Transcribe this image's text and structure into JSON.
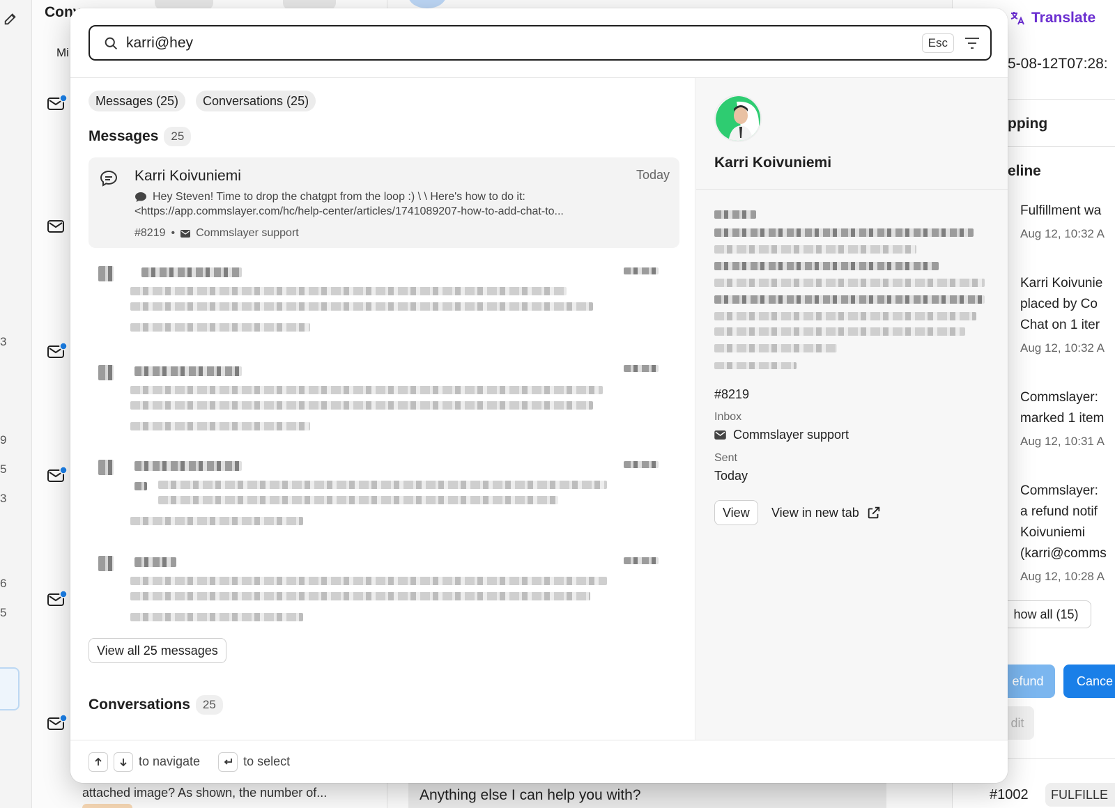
{
  "background": {
    "list_title": "Conv",
    "filter_label": "Mi",
    "rail_numbers": [
      "3",
      "9",
      "5",
      "3",
      "6",
      "5"
    ],
    "list_snippet": "attached image? As shown, the number of...",
    "chat_snippet": "Anything else I can help you with?",
    "translate_label": "Translate",
    "right_panel": {
      "timestamp": "5-08-12T07:28:",
      "shipping": "pping",
      "timeline": "eline",
      "events": [
        {
          "line1": "Fulfillment wa",
          "line2": "",
          "line3": "",
          "time": "Aug 12, 10:32 A"
        },
        {
          "line1": "Karri Koivunie",
          "line2": "placed by Co",
          "line3": "Chat on 1 iter",
          "time": "Aug 12, 10:32 A"
        },
        {
          "line1": "Commslayer:",
          "line2": "marked 1 item",
          "line3": "",
          "time": "Aug 12, 10:31 A"
        },
        {
          "line1": "Commslayer:",
          "line2": "a refund notif",
          "line3": "Koivuniemi",
          "line4": "(karri@comms",
          "time": "Aug 12, 10:28 A"
        }
      ],
      "show_all": "how all (15)",
      "refund": "efund",
      "cancel": "Cance",
      "edit": "dit",
      "order_number": "#1002",
      "order_status": "FULFILLE"
    }
  },
  "modal": {
    "search": {
      "value": "karri@hey",
      "esc_label": "Esc"
    },
    "filter_chips": [
      "Messages (25)",
      "Conversations (25)"
    ],
    "messages_section": {
      "title": "Messages",
      "count": "25"
    },
    "conversations_section": {
      "title": "Conversations",
      "count": "25"
    },
    "selected_message": {
      "name": "Karri Koivuniemi",
      "time": "Today",
      "preview_line1": "Hey Steven! Time to drop the chatgpt from the loop :) \\ \\ Here's how to do it:",
      "preview_line2": "<https://app.commslayer.com/hc/help-center/articles/1741089207-how-to-add-chat-to...",
      "ticket": "#8219",
      "separator": "•",
      "inbox": "Commslayer support"
    },
    "view_all_label": "View all 25 messages",
    "detail": {
      "name": "Karri Koivuniemi",
      "ticket": "#8219",
      "inbox_label": "Inbox",
      "inbox_value": "Commslayer support",
      "sent_label": "Sent",
      "sent_value": "Today",
      "view_label": "View",
      "view_new_tab_label": "View in new tab"
    },
    "footer": {
      "navigate_label": "to navigate",
      "select_label": "to select"
    }
  },
  "colors": {
    "accent_purple": "#6b2fd0",
    "badge_blue": "#1a7fe8",
    "cancel_blue": "#1a7fe8",
    "avatar_green": "#2ecc71"
  }
}
